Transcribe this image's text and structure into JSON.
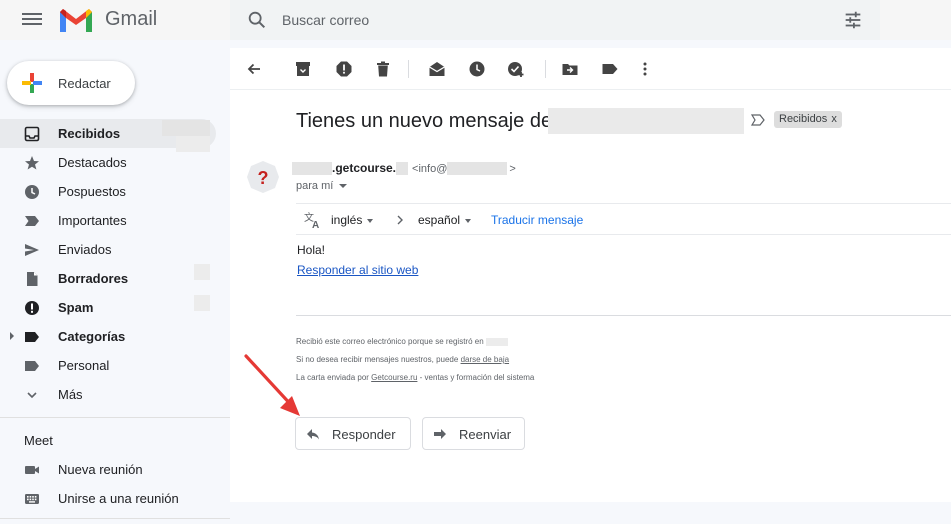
{
  "header": {
    "brand": "Gmail",
    "search_placeholder": "Buscar correo"
  },
  "compose": {
    "label": "Redactar"
  },
  "sidebar": {
    "items": [
      {
        "label": "Recibidos",
        "icon": "inbox-icon",
        "bold": true,
        "active": true
      },
      {
        "label": "Destacados",
        "icon": "star-icon",
        "bold": false
      },
      {
        "label": "Pospuestos",
        "icon": "clock-icon",
        "bold": false
      },
      {
        "label": "Importantes",
        "icon": "label-important-icon",
        "bold": false
      },
      {
        "label": "Enviados",
        "icon": "send-icon",
        "bold": false
      },
      {
        "label": "Borradores",
        "icon": "draft-icon",
        "bold": true
      },
      {
        "label": "Spam",
        "icon": "spam-icon",
        "bold": true
      },
      {
        "label": "Categorías",
        "icon": "label-icon",
        "bold": true,
        "expandable": true
      },
      {
        "label": "Personal",
        "icon": "label-icon",
        "bold": false
      },
      {
        "label": "Más",
        "icon": "chevron-down-icon",
        "bold": false
      }
    ]
  },
  "meet": {
    "heading": "Meet",
    "items": [
      {
        "label": "Nueva reunión",
        "icon": "video-icon"
      },
      {
        "label": "Unirse a una reunión",
        "icon": "keyboard-icon"
      }
    ]
  },
  "message": {
    "subject": "Tienes un nuevo mensaje de",
    "tag": "Recibidos",
    "tag_close": "x",
    "sender_name": ".getcourse.",
    "sender_email": "<info@",
    "sender_email_end": ">",
    "recipient": "para mí",
    "translate": {
      "from": "inglés",
      "to": "español",
      "link": "Traducir mensaje"
    },
    "greeting": "Hola!",
    "reply_link": "Responder al sitio web",
    "footer": {
      "line1": "Recibió este correo electrónico porque se registró en",
      "line2_pre": "Si no desea recibir mensajes nuestros, puede",
      "line2_link": "darse de baja",
      "line3_pre": "La carta enviada por",
      "line3_link": "Getcourse.ru",
      "line3_post": "- ventas y formación del sistema"
    },
    "reply_button": "Responder",
    "forward_button": "Reenviar"
  },
  "colors": {
    "annotation_arrow": "#e53935",
    "link": "#1a73e8"
  }
}
